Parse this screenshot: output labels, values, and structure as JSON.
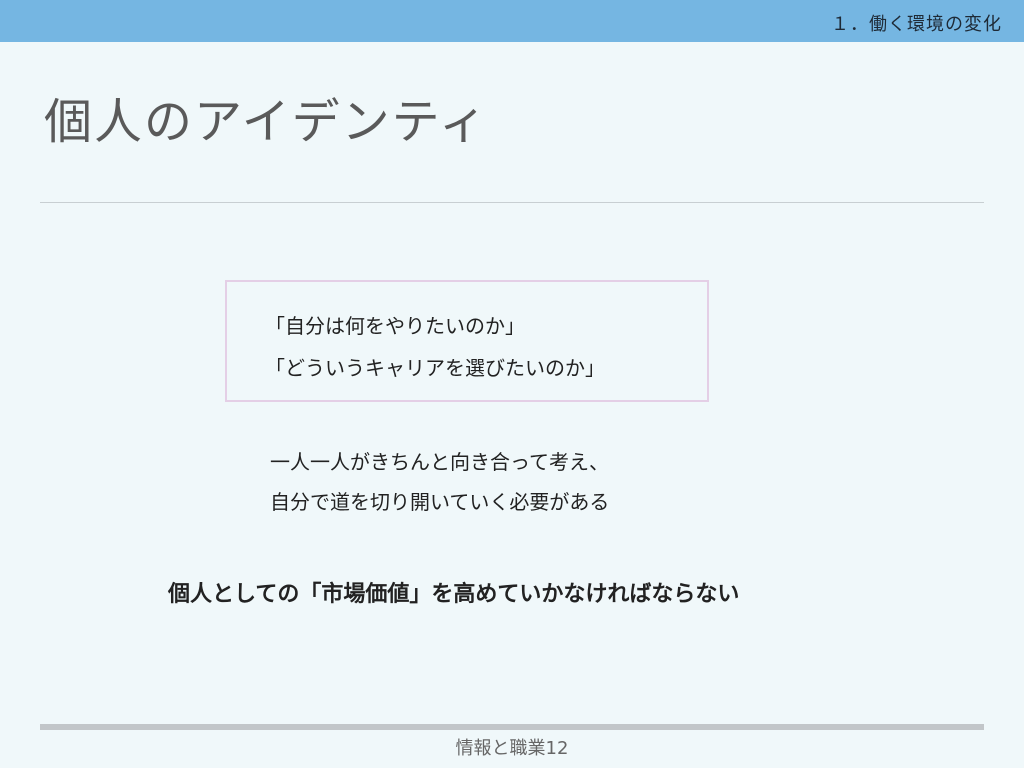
{
  "header": {
    "section": "１．働く環境の変化"
  },
  "slide": {
    "title": "個人のアイデンティ",
    "quotes": [
      "「自分は何をやりたいのか」",
      "「どういうキャリアを選びたいのか」"
    ],
    "body": [
      "一人一人がきちんと向き合って考え、",
      "自分で道を切り開いていく必要がある"
    ],
    "conclusion": "個人としての「市場価値」を高めていかなければならない"
  },
  "footer": {
    "label": "情報と職業12"
  },
  "colors": {
    "header_bar": "#75b6e2",
    "background": "#f0f8fa",
    "quote_border": "#e4cfe6",
    "footer_rule": "#c2c6c9"
  }
}
